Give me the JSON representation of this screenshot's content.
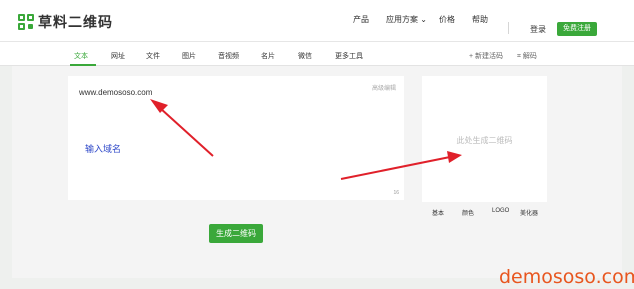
{
  "brand": {
    "name": "草料二维码",
    "color": "#3aa83a"
  },
  "nav": {
    "product": "产品",
    "solutions": "应用方案",
    "pricing": "价格",
    "help": "帮助",
    "login": "登录",
    "register": "免费注册"
  },
  "tabs": [
    "文本",
    "网址",
    "文件",
    "图片",
    "音视频",
    "名片",
    "微信",
    "更多工具"
  ],
  "toolbar": {
    "new_batch": "新建活码",
    "decode": "解码"
  },
  "editor": {
    "content": "www.demososo.com",
    "advanced": "高级编辑",
    "char_count": "16",
    "hint": "输入域名"
  },
  "qr": {
    "placeholder": "此处生成二维码",
    "options": [
      "基本",
      "颜色",
      "LOGO",
      "美化器"
    ]
  },
  "generate_button": "生成二维码",
  "watermark": "demososo.com",
  "colors": {
    "accent": "#3aa83a",
    "annotation_arrow": "#e0202a",
    "hint_text": "#2f49c9",
    "watermark": "#e8561f"
  }
}
